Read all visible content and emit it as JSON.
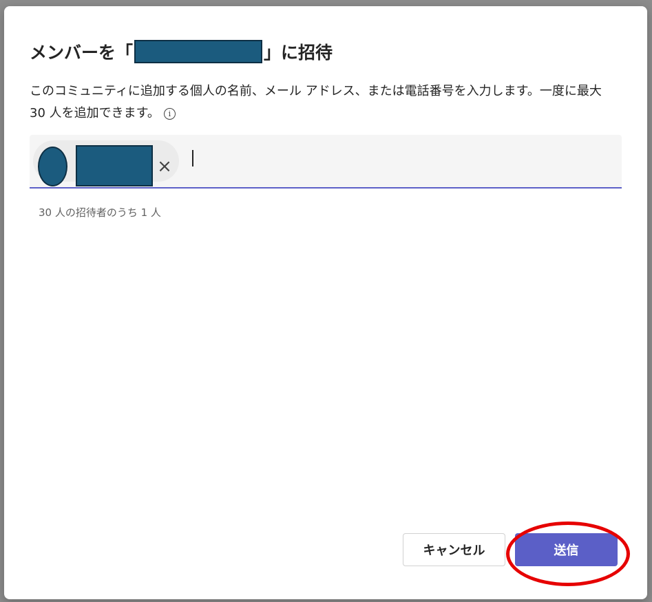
{
  "dialog": {
    "title_prefix": "メンバーを「",
    "title_suffix": "」に招待",
    "description": "このコミュニティに追加する個人の名前、メール アドレス、または電話番号を入力します。一度に最大 30 人を追加できます。",
    "info_icon": "i",
    "chip_remove_glyph": "×",
    "counter": "30 人の招待者のうち 1 人",
    "cancel_label": "キャンセル",
    "send_label": "送信"
  },
  "colors": {
    "accent": "#5b5fc7",
    "redaction": "#1b5b7e",
    "highlight": "#e60000"
  }
}
